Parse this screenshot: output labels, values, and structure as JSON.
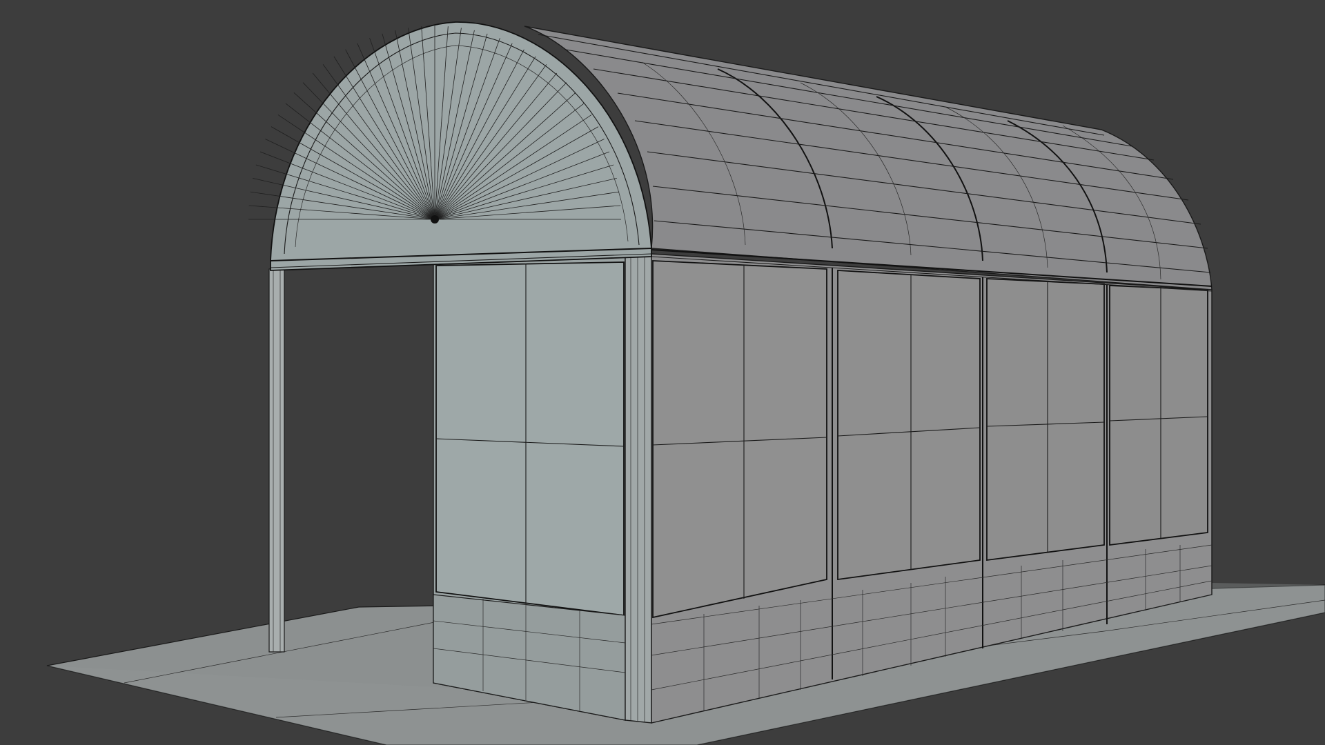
{
  "viewport": {
    "background_color": "#3d3d3d",
    "shading": "solid-with-wireframe"
  },
  "model": {
    "object": "arched-bus-shelter",
    "surface_colors": {
      "ground": "#8c9090",
      "front_face": "#9ba3a3",
      "side_face": "#8e8e8f",
      "roof": "#8b8a8c",
      "wire": "#1a1a1a"
    },
    "bays": 4
  }
}
